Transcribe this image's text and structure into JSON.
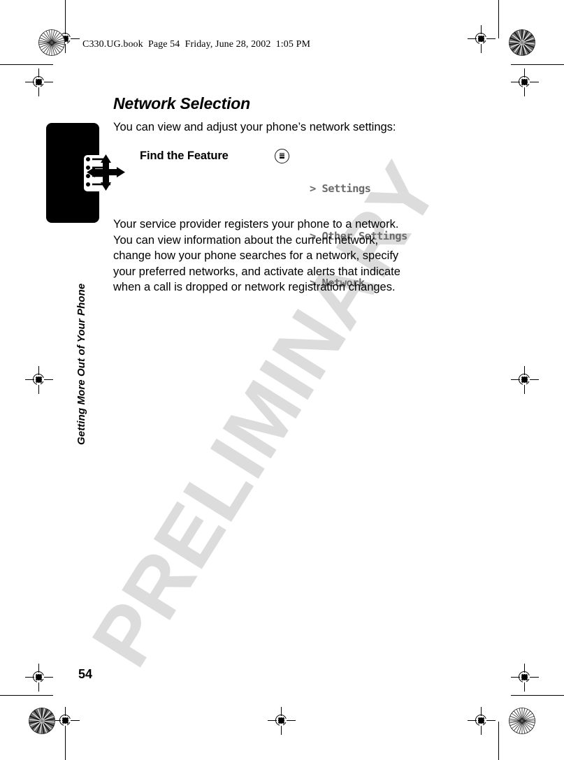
{
  "page": {
    "book_header": "C330.UG.book  Page 54  Friday, June 28, 2002  1:05 PM",
    "number": "54",
    "watermark": "PRELIMINARY",
    "chapter_title": "Getting More Out of Your Phone"
  },
  "section": {
    "title": "Network Selection",
    "intro": "You can view and adjust your phone’s network settings:",
    "find_the_feature_label": "Find the Feature",
    "menu_key_icon": "menu-key-icon",
    "menu_path": [
      "> Settings",
      "> Other Settings",
      "> Network"
    ],
    "body_lines": [
      "Your service provider registers your phone to a network.",
      "You can view information about the current network,",
      "change how your phone searches for a network, specify",
      "your preferred networks, and activate alerts that indicate",
      "when a call is dropped or network registration changes."
    ]
  },
  "colors": {
    "text": "#000000",
    "menu_path": "#6b6b6b",
    "watermark": "#dcdcdc",
    "tab": "#000000"
  },
  "print_marks": {
    "rosette_icon": "rosette-icon",
    "registration_icon": "registration-target-icon",
    "crop_line": "crop-line"
  }
}
